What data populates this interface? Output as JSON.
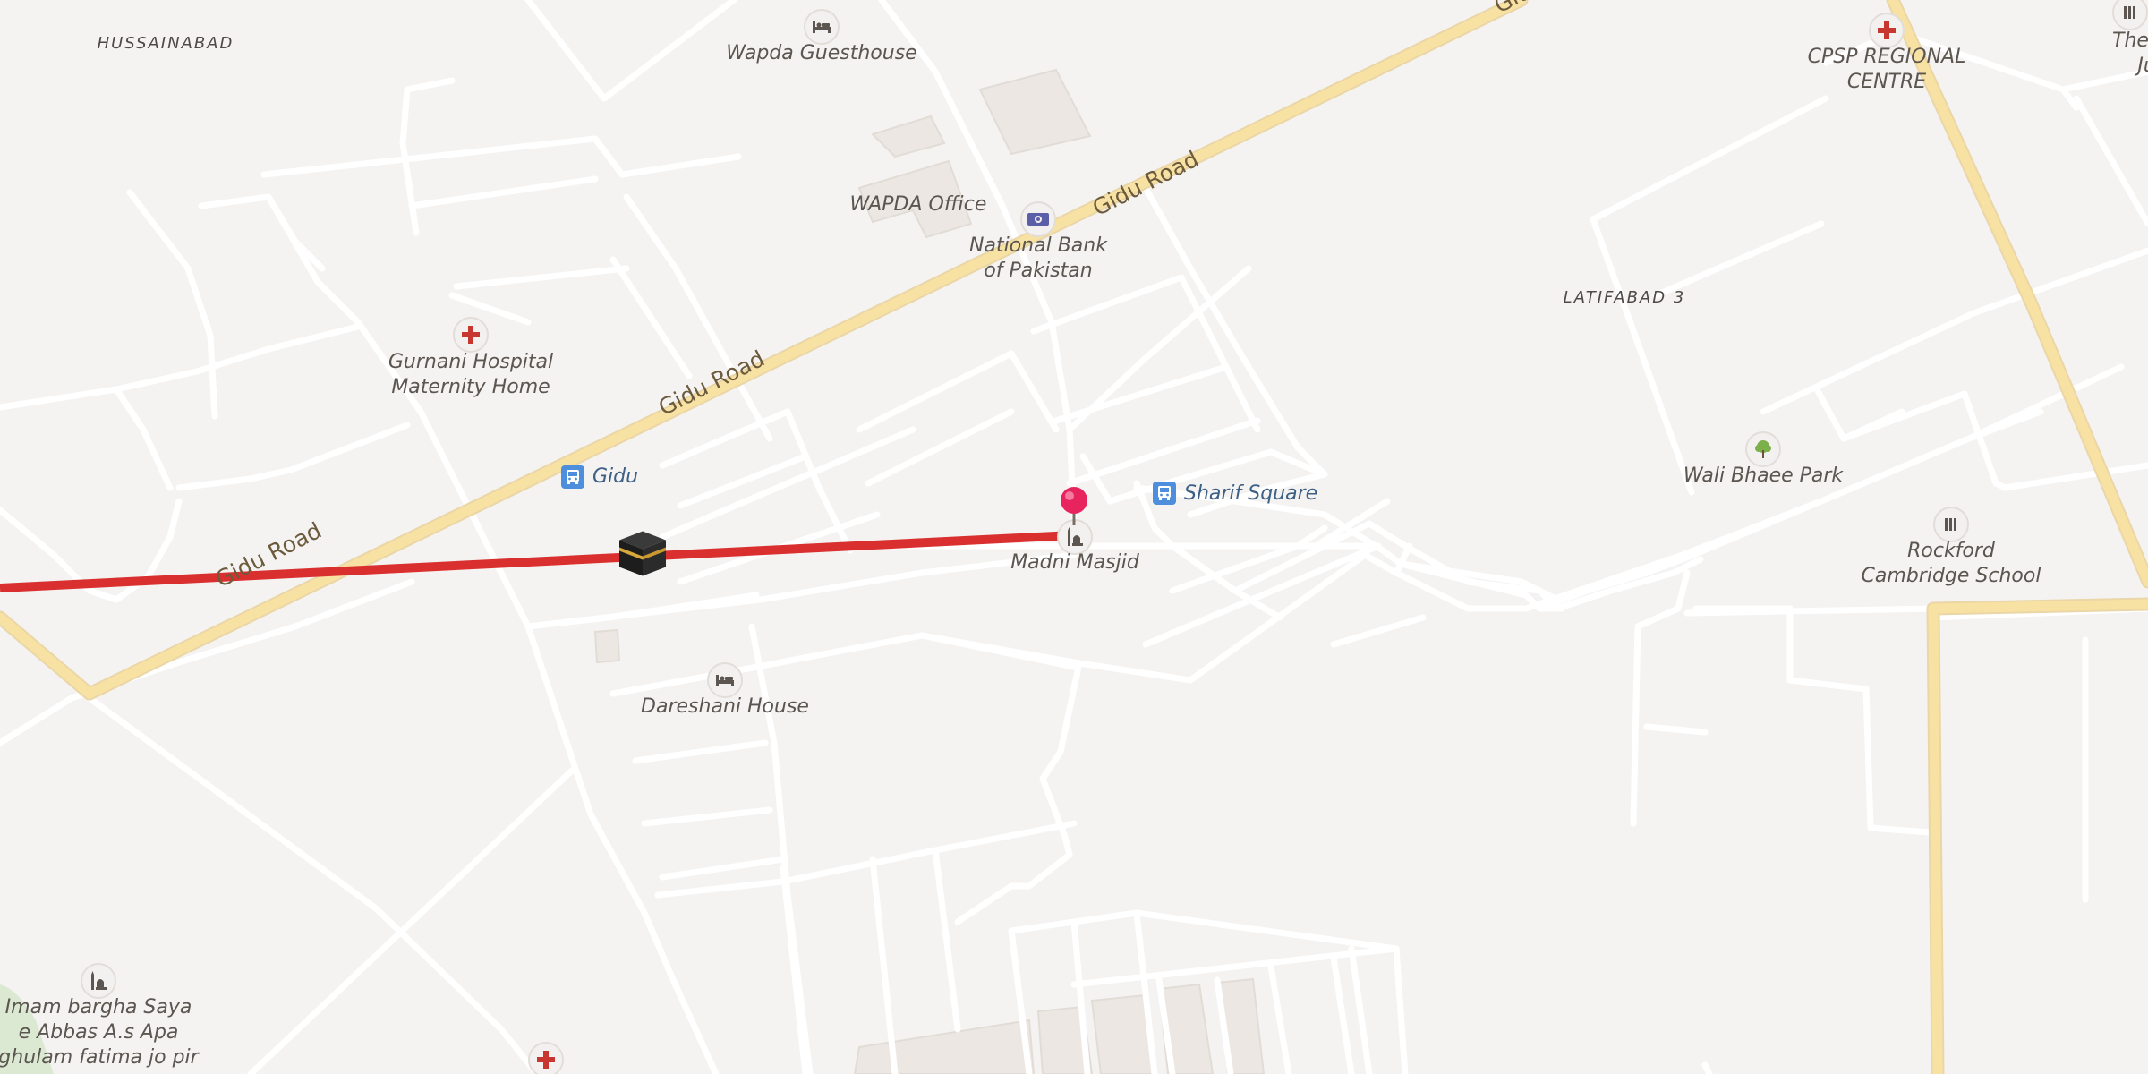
{
  "map": {
    "route_color": "#d9302f",
    "road_major_color": "#f7dd96",
    "road_minor_color": "#ffffff",
    "background_color": "#f5f3f1"
  },
  "areas": {
    "hussainabad": "HUSSAINABAD",
    "latifabad": "LATIFABAD 3"
  },
  "roads": {
    "gidu_1": "Gidu Road",
    "gidu_2": "Gidu Road",
    "gidu_3": "Gidu Road",
    "gidu_4": "Gid"
  },
  "places": {
    "wapda_guesthouse": "Wapda Guesthouse",
    "wapda_office": "WAPDA Office",
    "national_bank_1": "National Bank",
    "national_bank_2": "of Pakistan",
    "cpsp_1": "CPSP REGIONAL",
    "cpsp_2": "CENTRE",
    "city_school_1": "The City Sc",
    "city_school_2": "Junior La",
    "gurnani_1": "Gurnani Hospital",
    "gurnani_2": "Maternity Home",
    "madni_masjid": "Madni Masjid",
    "wali_bhaee_park": "Wali Bhaee Park",
    "rockford_1": "Rockford",
    "rockford_2": "Cambridge School",
    "dareshani_house": "Dareshani House",
    "imam_1": "Imam bargha Saya",
    "imam_2": "e Abbas A.s Apa",
    "imam_3": "ghulam fatima jo pir"
  },
  "transit": {
    "gidu_stop": "Gidu",
    "sharif_square": "Sharif Square"
  },
  "icons": {
    "hotel": "bed-icon",
    "hospital": "red-cross-icon",
    "bank": "banknote-icon",
    "mosque": "mosque-icon",
    "park": "tree-icon",
    "school": "school-icon",
    "bus": "bus-stop-icon",
    "pin": "location-pin-icon",
    "kaaba": "kaaba-icon"
  }
}
